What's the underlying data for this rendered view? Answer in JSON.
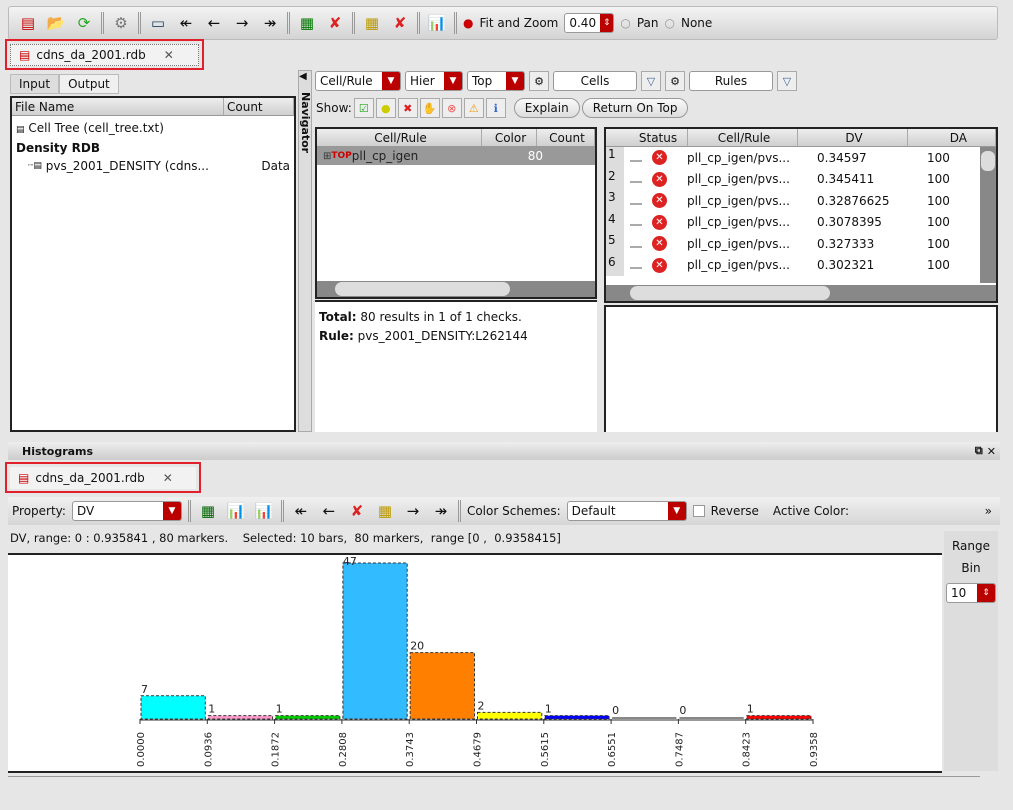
{
  "toolbar": {
    "fit_zoom_label": "Fit and Zoom",
    "zoom_value": "0.40",
    "pan_label": "Pan",
    "none_label": "None"
  },
  "file_tab": {
    "label": "cdns_da_2001.rdb",
    "close": "✕"
  },
  "left_panel": {
    "tabs": [
      "Input",
      "Output"
    ],
    "columns": [
      "File Name",
      "Count"
    ],
    "items": [
      {
        "label": "Cell Tree (cell_tree.txt)",
        "count": ""
      },
      {
        "label": "Density RDB",
        "count": ""
      },
      {
        "label": "pvs_2001_DENSITY (cdns...",
        "count": "Data"
      }
    ]
  },
  "navigator": {
    "label": "Navigator"
  },
  "filters": {
    "cell_rule": "Cell/Rule",
    "hier": "Hier",
    "top": "Top",
    "cells": "Cells",
    "rules": "Rules",
    "show_label": "Show:",
    "explain": "Explain",
    "return_on_top": "Return On Top"
  },
  "cell_table": {
    "columns": [
      "Cell/Rule",
      "Color",
      "Count"
    ],
    "rows": [
      {
        "name": "pll_cp_igen",
        "count": "80"
      }
    ]
  },
  "summary": {
    "total_label": "Total:",
    "total_text": "80 results in 1 of 1 checks.",
    "rule_label": "Rule:",
    "rule_text": "pvs_2001_DENSITY:L262144"
  },
  "results_table": {
    "columns": [
      "Status",
      "Cell/Rule",
      "DV",
      "DA"
    ],
    "rows": [
      {
        "n": "1",
        "cell": "pll_cp_igen/pvs...",
        "dv": "0.34597",
        "da": "100"
      },
      {
        "n": "2",
        "cell": "pll_cp_igen/pvs...",
        "dv": "0.345411",
        "da": "100"
      },
      {
        "n": "3",
        "cell": "pll_cp_igen/pvs...",
        "dv": "0.32876625",
        "da": "100"
      },
      {
        "n": "4",
        "cell": "pll_cp_igen/pvs...",
        "dv": "0.3078395",
        "da": "100"
      },
      {
        "n": "5",
        "cell": "pll_cp_igen/pvs...",
        "dv": "0.327333",
        "da": "100"
      },
      {
        "n": "6",
        "cell": "pll_cp_igen/pvs...",
        "dv": "0.302321",
        "da": "100"
      }
    ]
  },
  "histograms": {
    "title": "Histograms",
    "property_label": "Property:",
    "property_value": "DV",
    "color_schemes_label": "Color Schemes:",
    "color_scheme_value": "Default",
    "reverse_label": "Reverse",
    "active_color_label": "Active Color:",
    "more": "»",
    "status": "DV, range: 0 : 0.935841 , 80 markers.    Selected: 10 bars,  80 markers,  range [0 ,  0.9358415]",
    "range_label": "Range",
    "bin_label": "Bin",
    "bin_value": "10"
  },
  "chart_data": {
    "type": "bar",
    "values": [
      7,
      1,
      1,
      47,
      20,
      2,
      1,
      0,
      0,
      1
    ],
    "tick_labels": [
      "0.0000",
      "0.0936",
      "0.1872",
      "0.2808",
      "0.3743",
      "0.4679",
      "0.5615",
      "0.6551",
      "0.7487",
      "0.8423",
      "0.9358"
    ],
    "colors": [
      "#00ffff",
      "#ff99cc",
      "#00cc00",
      "#33bbff",
      "#ff8000",
      "#ffff00",
      "#0000ff",
      "#888888",
      "#888888",
      "#ff0000"
    ],
    "xlim": [
      0,
      0.9358
    ],
    "ylim": [
      0,
      47
    ]
  }
}
